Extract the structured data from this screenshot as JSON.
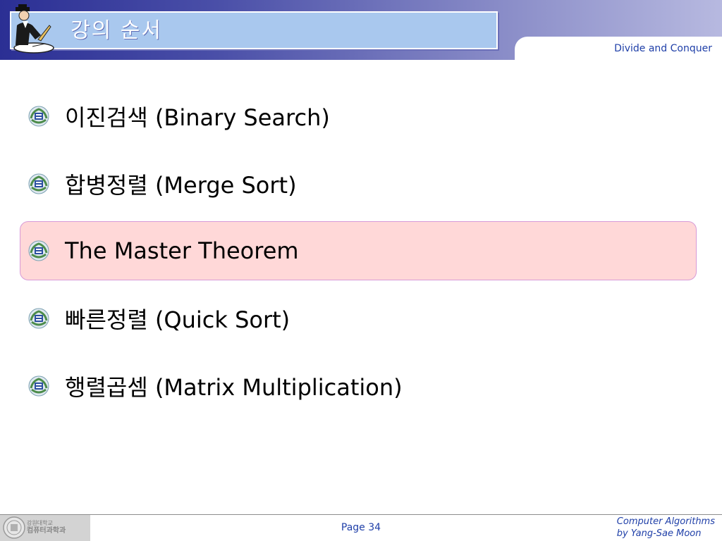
{
  "header": {
    "title": "강의 순서",
    "subtitle": "Divide and Conquer"
  },
  "bullets": [
    {
      "ko": "이진검색",
      "en": "(Binary Search)"
    },
    {
      "ko": "합병정렬",
      "en": "(Merge Sort)"
    },
    {
      "ko": "",
      "en": "The Master Theorem",
      "highlighted": true
    },
    {
      "ko": "빠른정렬",
      "en": "(Quick Sort)"
    },
    {
      "ko": "행렬곱셈",
      "en": "(Matrix Multiplication)"
    }
  ],
  "footer": {
    "dept_line1": "강원대학교",
    "dept_line2": "컴퓨터과학과",
    "page": "Page 34",
    "course_line1": "Computer Algorithms",
    "course_line2": "by Yang-Sae Moon"
  },
  "colors": {
    "header_dark": "#2b2f94",
    "title_box": "#a9c8ee",
    "highlight": "#ffd8d8",
    "footer_text": "#1f3fa8"
  },
  "icons": {
    "header": "scholar-writing-icon",
    "bullet": "university-emblem-icon",
    "footer": "university-seal-icon"
  }
}
